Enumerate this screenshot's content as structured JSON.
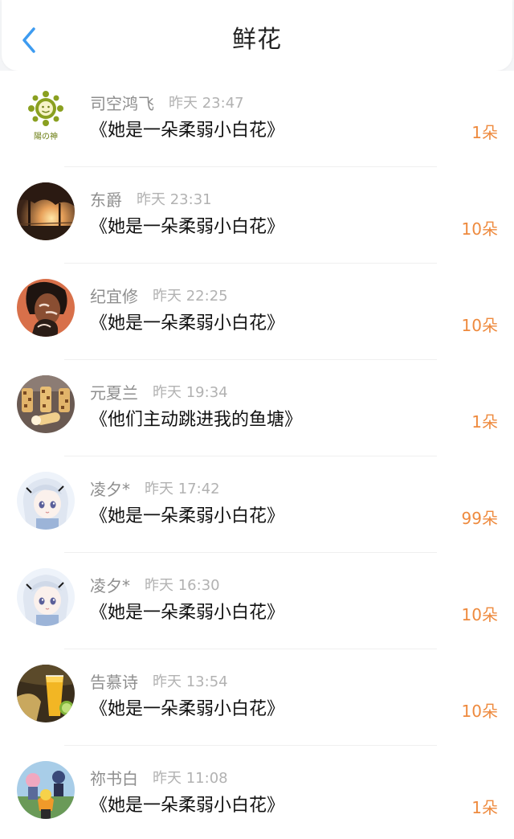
{
  "header": {
    "title": "鲜花",
    "back_icon": "chevron-left-icon",
    "back_color": "#3d9bf0"
  },
  "accent_color": "#ee8a3e",
  "items": [
    {
      "name": "司空鸿飞",
      "time": "昨天 23:47",
      "book": "《她是一朵柔弱小白花》",
      "count": "1朵",
      "avatar_caption": "陽の神"
    },
    {
      "name": "东爵",
      "time": "昨天 23:31",
      "book": "《她是一朵柔弱小白花》",
      "count": "10朵"
    },
    {
      "name": "纪宜修",
      "time": "昨天 22:25",
      "book": "《她是一朵柔弱小白花》",
      "count": "10朵"
    },
    {
      "name": "元夏兰",
      "time": "昨天 19:34",
      "book": "《他们主动跳进我的鱼塘》",
      "count": "1朵"
    },
    {
      "name": "凌夕*",
      "time": "昨天 17:42",
      "book": "《她是一朵柔弱小白花》",
      "count": "99朵"
    },
    {
      "name": "凌夕*",
      "time": "昨天 16:30",
      "book": "《她是一朵柔弱小白花》",
      "count": "10朵"
    },
    {
      "name": "告慕诗",
      "time": "昨天 13:54",
      "book": "《她是一朵柔弱小白花》",
      "count": "10朵"
    },
    {
      "name": "祢书白",
      "time": "昨天 11:08",
      "book": "《她是一朵柔弱小白花》",
      "count": "1朵"
    }
  ]
}
